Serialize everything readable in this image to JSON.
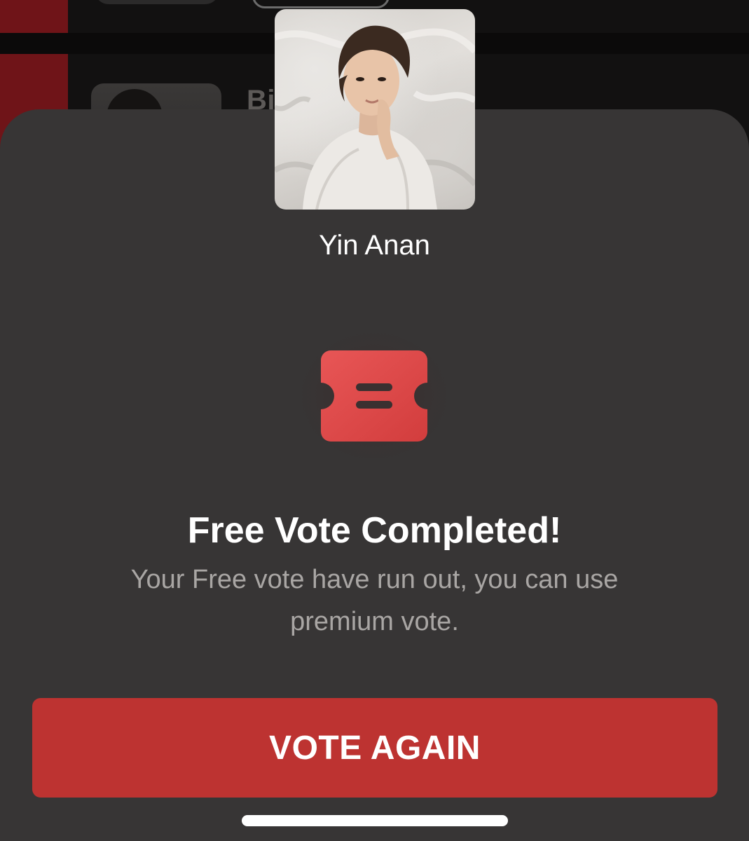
{
  "background_list": {
    "row_2_name": "Bi                          ng"
  },
  "dialog": {
    "artist_name": "Yin Anan",
    "artist_photo_alt": "Yin Anan",
    "icon": "ticket-icon",
    "title": "Free Vote Completed!",
    "message": "Your Free vote have run out, you can use premium vote.",
    "button_label": "VOTE AGAIN"
  },
  "colors": {
    "sheet_background": "#373535",
    "accent_red": "#bd3331",
    "ticket_red": "#e04a4a",
    "rank_strip_red": "#6f1418"
  }
}
